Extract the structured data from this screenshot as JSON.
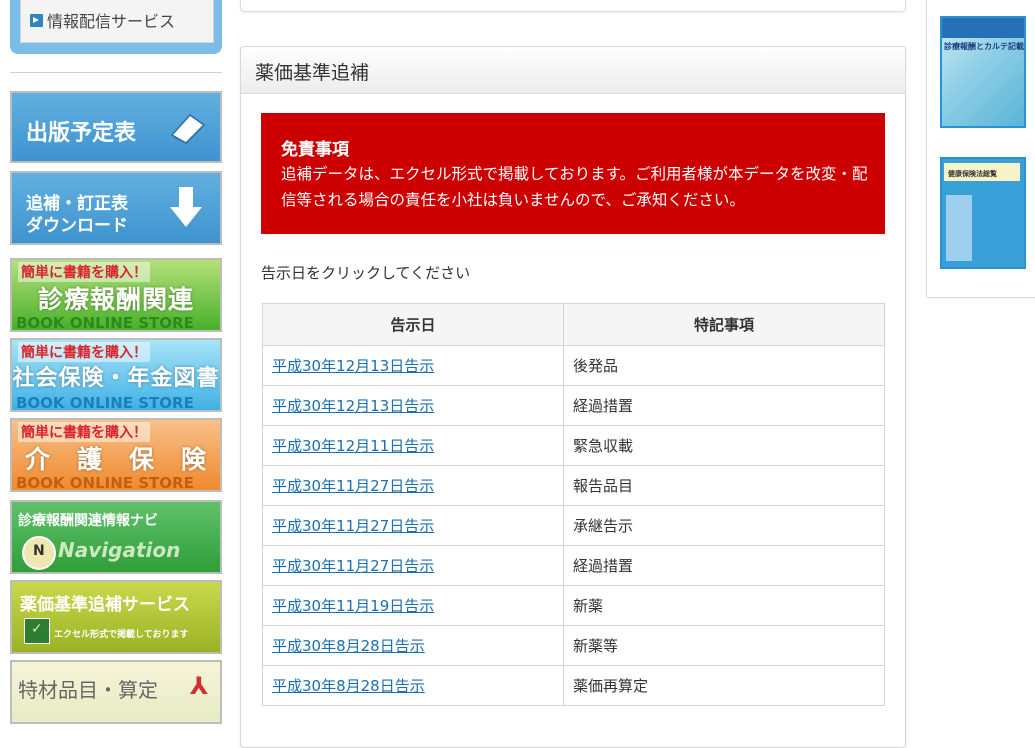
{
  "left_nav": {
    "service_link": "情報配信サービス",
    "banners": {
      "publish_schedule": "出版予定表",
      "download_line1": "追補・訂正表",
      "download_line2": "ダウンロード",
      "store_top": "簡単に書籍を購入！",
      "store_sub": "BOOK ONLINE STORE",
      "store1_main": "診療報酬関連",
      "store2_main": "社会保険・年金図書",
      "store3_main": "介　護　保　険",
      "navi_title": "診療報酬関連情報ナビ",
      "navi_sub": "Navigation",
      "yakka_title": "薬価基準追補サービス",
      "yakka_sub": "エクセル形式で掲載しております",
      "tokuzai_title": "特材品目・算定"
    }
  },
  "panel": {
    "title": "薬価基準追補",
    "disclaimer": {
      "heading": "免責事項",
      "body": "追補データは、エクセル形式で掲載しております。ご利用者様が本データを改変・配信等される場合の責任を小社は負いませんので、ご承知ください。"
    },
    "instruction": "告示日をクリックしてください",
    "table": {
      "headers": [
        "告示日",
        "特記事項"
      ],
      "rows": [
        {
          "date": "平成30年12月13日告示",
          "note": "後発品"
        },
        {
          "date": "平成30年12月13日告示",
          "note": "経過措置"
        },
        {
          "date": "平成30年12月11日告示",
          "note": "緊急収載"
        },
        {
          "date": "平成30年11月27日告示",
          "note": "報告品目"
        },
        {
          "date": "平成30年11月27日告示",
          "note": "承継告示"
        },
        {
          "date": "平成30年11月27日告示",
          "note": "経過措置"
        },
        {
          "date": "平成30年11月19日告示",
          "note": "新薬"
        },
        {
          "date": "平成30年8月28日告示",
          "note": "新薬等"
        },
        {
          "date": "平成30年8月28日告示",
          "note": "薬価再算定"
        }
      ]
    }
  },
  "right_books": {
    "book1_title": "診療報酬とカルテ記載",
    "book2_title": "健康保険法総覧"
  },
  "colors": {
    "disclaimer_bg": "#cc0000",
    "link": "#1a6fb3",
    "banner_blue": "#3e93cf"
  }
}
